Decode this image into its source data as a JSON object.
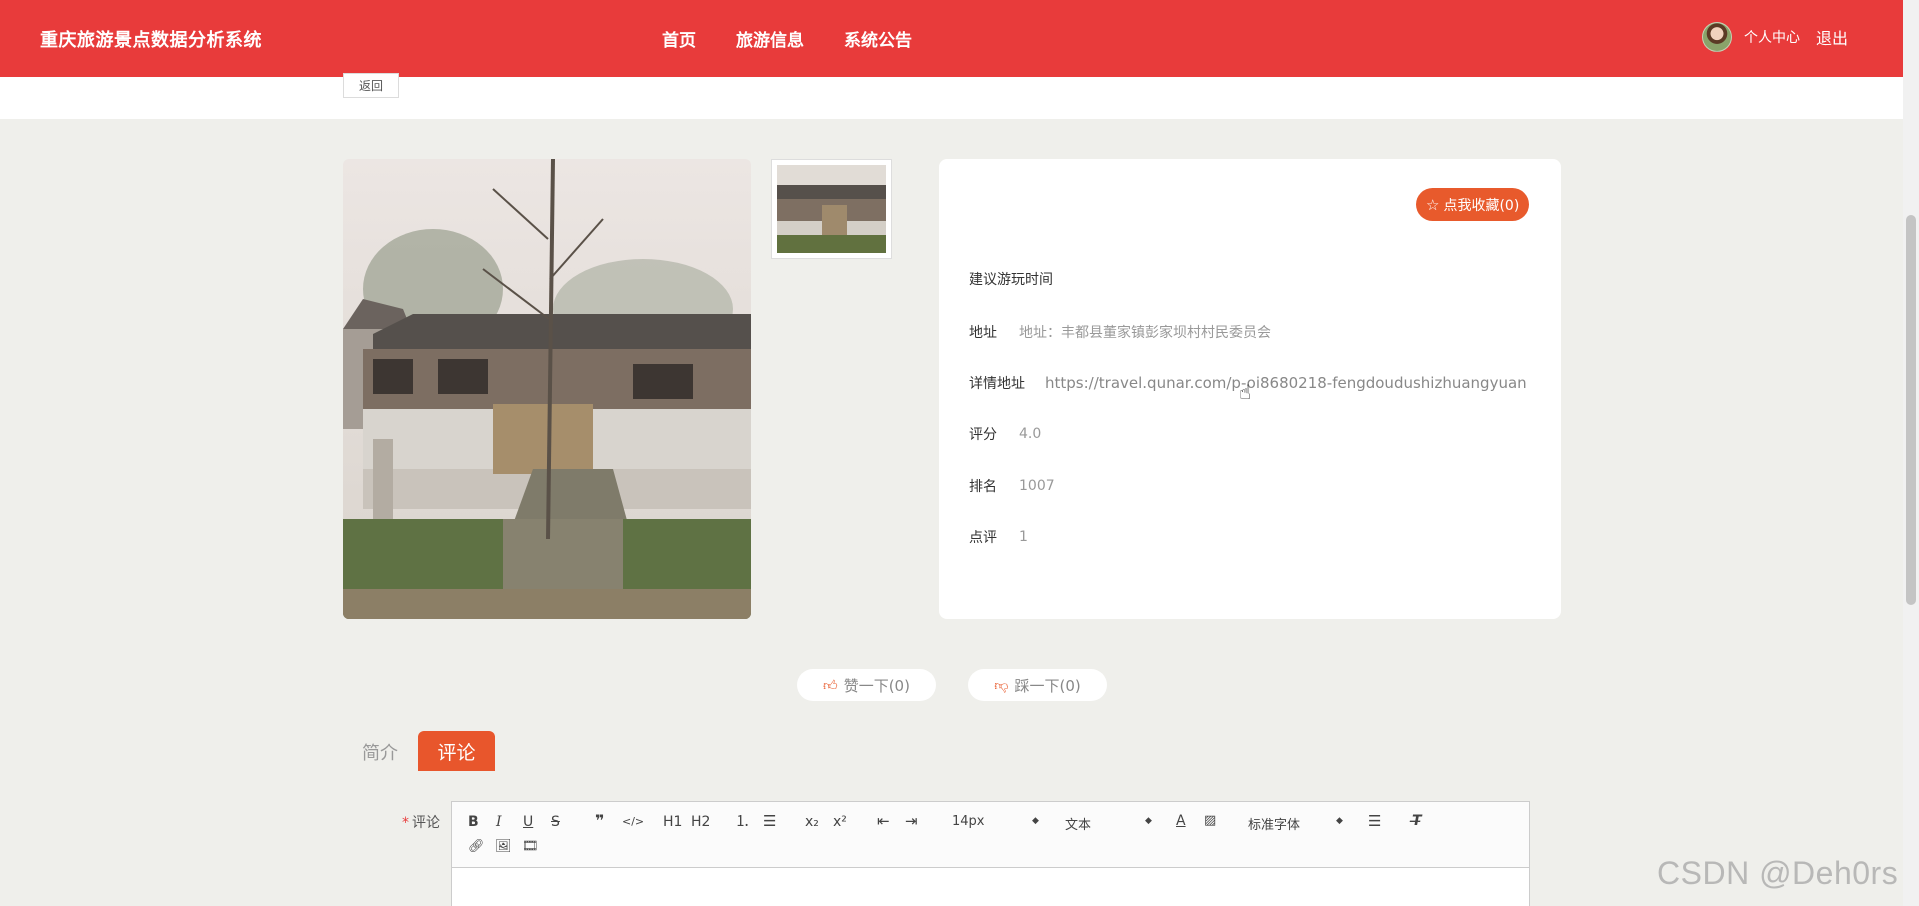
{
  "header": {
    "brand": "重庆旅游景点数据分析系统",
    "nav": [
      "首页",
      "旅游信息",
      "系统公告"
    ],
    "user_center": "个人中心",
    "logout": "退出"
  },
  "back_label": "返回",
  "favorite": {
    "label": "点我收藏(0)"
  },
  "details": {
    "suggested_time_label": "建议游玩时间",
    "address_label": "地址",
    "address_value": "地址：丰都县董家镇彭家坝村村民委员会",
    "detail_url_label": "详情地址",
    "detail_url_value": "https://travel.qunar.com/p-oi8680218-fengdoudushizhuangyuan",
    "rating_label": "评分",
    "rating_value": "4.0",
    "rank_label": "排名",
    "rank_value": "1007",
    "reviews_label": "点评",
    "reviews_value": "1"
  },
  "votes": {
    "like": "赞一下(0)",
    "dislike": "踩一下(0)"
  },
  "tabs": [
    "简介",
    "评论"
  ],
  "comment": {
    "label": "评论",
    "toolbar": {
      "h1": "H1",
      "h2": "H2",
      "size": "14px",
      "format": "文本",
      "font": "标准字体"
    }
  },
  "watermark": "CSDN @Deh0rs",
  "colors": {
    "header": "#e83b3b",
    "accent": "#e8562c"
  }
}
